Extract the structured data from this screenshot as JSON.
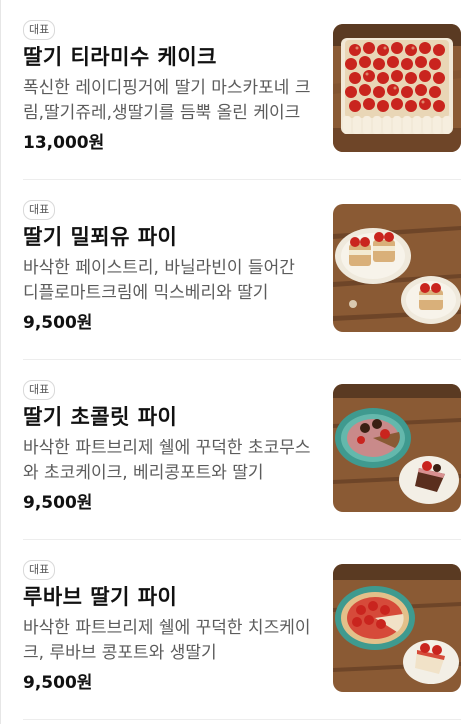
{
  "menu": {
    "items": [
      {
        "badge": "대표",
        "name": "딸기 티라미수 케이크",
        "description": "폭신한 레이디핑거에 딸기 마스카포네 크림,딸기쥬레,생딸기를 듬뿍 올린 케이크",
        "price": "13,000원",
        "photo": "strawberry-tiramisu-cake"
      },
      {
        "badge": "대표",
        "name": "딸기 밀푀유 파이",
        "description": "바삭한 페이스트리, 바닐라빈이 들어간 디플로마트크림에 믹스베리와 딸기",
        "price": "9,500원",
        "photo": "strawberry-millefeuille-pie"
      },
      {
        "badge": "대표",
        "name": "딸기 초콜릿 파이",
        "description": "바삭한 파트브리제 쉘에 꾸덕한 초코무스와 초코케이크, 베리콩포트와 딸기",
        "price": "9,500원",
        "photo": "strawberry-chocolate-pie"
      },
      {
        "badge": "대표",
        "name": "루바브 딸기 파이",
        "description": "바삭한 파트브리제 쉘에 꾸덕한 치즈케이크, 루바브 콩포트와 생딸기",
        "price": "9,500원",
        "photo": "rhubarb-strawberry-pie"
      }
    ]
  },
  "colors": {
    "text": "#111111",
    "description": "#5c5c5c",
    "badge_border": "#d9d9d9",
    "divider": "#ededed",
    "strawberry": "#c9241e",
    "wood": "#8a5a34"
  }
}
